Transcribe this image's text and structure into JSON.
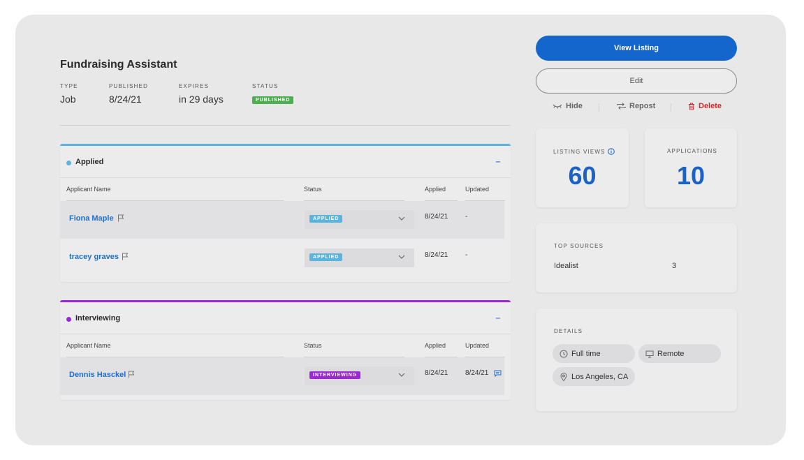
{
  "job": {
    "title": "Fundraising Assistant",
    "type_label": "TYPE",
    "type_value": "Job",
    "published_label": "PUBLISHED",
    "published_value": "8/24/21",
    "expires_label": "EXPIRES",
    "expires_value": "in 29 days",
    "status_label": "STATUS",
    "status_value": "PUBLISHED"
  },
  "columns": {
    "name": "Applicant Name",
    "status": "Status",
    "applied": "Applied",
    "updated": "Updated"
  },
  "groups": [
    {
      "name": "Applied",
      "color": "#5ab4e0",
      "collapse": "–",
      "rows": [
        {
          "name": "Fiona Maple",
          "status": "APPLIED",
          "applied": "8/24/21",
          "updated": "-"
        },
        {
          "name": "tracey graves",
          "status": "APPLIED",
          "applied": "8/24/21",
          "updated": "-"
        }
      ]
    },
    {
      "name": "Interviewing",
      "color": "#9c27d8",
      "collapse": "–",
      "rows": [
        {
          "name": "Dennis Hasckel",
          "status": "INTERVIEWING",
          "applied": "8/24/21",
          "updated": "8/24/21"
        }
      ]
    }
  ],
  "actions": {
    "view_listing": "View Listing",
    "edit": "Edit",
    "hide": "Hide",
    "repost": "Repost",
    "delete": "Delete"
  },
  "stats": {
    "views_label": "LISTING VIEWS",
    "views_value": "60",
    "applications_label": "APPLICATIONS",
    "applications_value": "10"
  },
  "sources": {
    "label": "TOP SOURCES",
    "items": [
      {
        "name": "Idealist",
        "count": "3"
      }
    ]
  },
  "details": {
    "label": "DETAILS",
    "chips": [
      "Full time",
      "Remote",
      "Los Angeles, CA"
    ]
  },
  "colors": {
    "primary": "#1566cc",
    "applied": "#5ab4e0",
    "interviewing": "#9c27d8",
    "published": "#4caf50",
    "delete": "#d4262b"
  }
}
